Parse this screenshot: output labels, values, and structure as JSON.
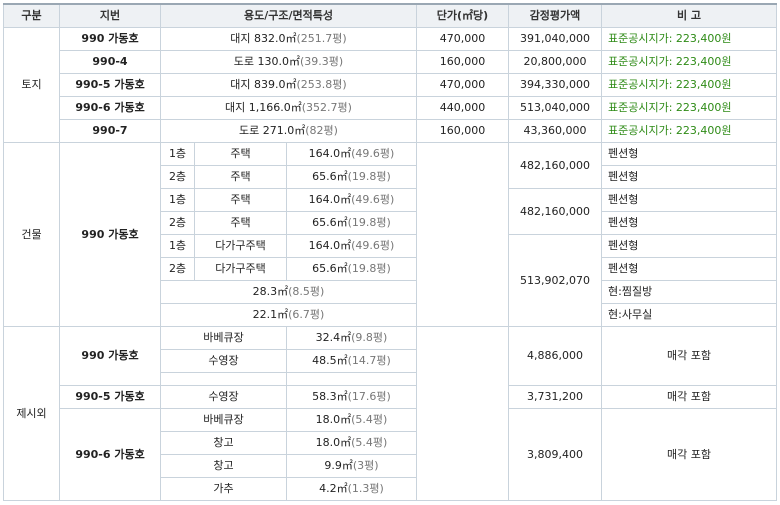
{
  "header": {
    "category": "구분",
    "lot": "지번",
    "usage": "용도/구조/면적특성",
    "unit_price": "단가(㎡당)",
    "appraised": "감정평가액",
    "note": "비 고"
  },
  "land": {
    "category": "토지",
    "rows": [
      {
        "lot": "990 가동호",
        "area_main": "대지 832.0㎡",
        "area_sub": "(251.7평)",
        "unit_price": "470,000",
        "appraised": "391,040,000",
        "note": "표준공시지가: 223,400원"
      },
      {
        "lot": "990-4",
        "area_main": "도로 130.0㎡",
        "area_sub": "(39.3평)",
        "unit_price": "160,000",
        "appraised": "20,800,000",
        "note": "표준공시지가: 223,400원"
      },
      {
        "lot": "990-5 가동호",
        "area_main": "대지 839.0㎡",
        "area_sub": "(253.8평)",
        "unit_price": "470,000",
        "appraised": "394,330,000",
        "note": "표준공시지가: 223,400원"
      },
      {
        "lot": "990-6 가동호",
        "area_main": "대지 1,166.0㎡",
        "area_sub": "(352.7평)",
        "unit_price": "440,000",
        "appraised": "513,040,000",
        "note": "표준공시지가: 223,400원"
      },
      {
        "lot": "990-7",
        "area_main": "도로 271.0㎡",
        "area_sub": "(82평)",
        "unit_price": "160,000",
        "appraised": "43,360,000",
        "note": "표준공시지가: 223,400원"
      }
    ]
  },
  "building": {
    "category": "건물",
    "lot": "990 가동호",
    "rows": [
      {
        "floor": "1층",
        "use": "주택",
        "area_main": "164.0㎡",
        "area_sub": "(49.6평)",
        "note": "펜션형"
      },
      {
        "floor": "2층",
        "use": "주택",
        "area_main": "65.6㎡",
        "area_sub": "(19.8평)",
        "note": "펜션형"
      },
      {
        "floor": "1층",
        "use": "주택",
        "area_main": "164.0㎡",
        "area_sub": "(49.6평)",
        "note": "펜션형"
      },
      {
        "floor": "2층",
        "use": "주택",
        "area_main": "65.6㎡",
        "area_sub": "(19.8평)",
        "note": "펜션형"
      },
      {
        "floor": "1층",
        "use": "다가구주택",
        "area_main": "164.0㎡",
        "area_sub": "(49.6평)",
        "note": "펜션형"
      },
      {
        "floor": "2층",
        "use": "다가구주택",
        "area_main": "65.6㎡",
        "area_sub": "(19.8평)",
        "note": "펜션형"
      }
    ],
    "extra": [
      {
        "area_main": "28.3㎡",
        "area_sub": "(8.5평)",
        "note": "현:찜질방"
      },
      {
        "area_main": "22.1㎡",
        "area_sub": "(6.7평)",
        "note": "현:사무실"
      }
    ],
    "appraised": [
      "482,160,000",
      "482,160,000",
      "513,902,070"
    ]
  },
  "exclusion": {
    "category": "제시외",
    "groups": [
      {
        "lot": "990 가동호",
        "items": [
          {
            "use": "바베큐장",
            "area_main": "32.4㎡",
            "area_sub": "(9.8평)"
          },
          {
            "use": "수영장",
            "area_main": "48.5㎡",
            "area_sub": "(14.7평)"
          },
          {
            "use": "",
            "area_main": "",
            "area_sub": ""
          }
        ],
        "appraised": "4,886,000",
        "note": "매각 포함"
      },
      {
        "lot": "990-5 가동호",
        "items": [
          {
            "use": "수영장",
            "area_main": "58.3㎡",
            "area_sub": "(17.6평)"
          }
        ],
        "appraised": "3,731,200",
        "note": "매각 포함"
      },
      {
        "lot": "990-6 가동호",
        "items": [
          {
            "use": "바베큐장",
            "area_main": "18.0㎡",
            "area_sub": "(5.4평)"
          },
          {
            "use": "창고",
            "area_main": "18.0㎡",
            "area_sub": "(5.4평)"
          },
          {
            "use": "창고",
            "area_main": "9.9㎡",
            "area_sub": "(3평)"
          },
          {
            "use": "가추",
            "area_main": "4.2㎡",
            "area_sub": "(1.3평)"
          }
        ],
        "appraised": "3,809,400",
        "note": "매각 포함"
      }
    ]
  }
}
